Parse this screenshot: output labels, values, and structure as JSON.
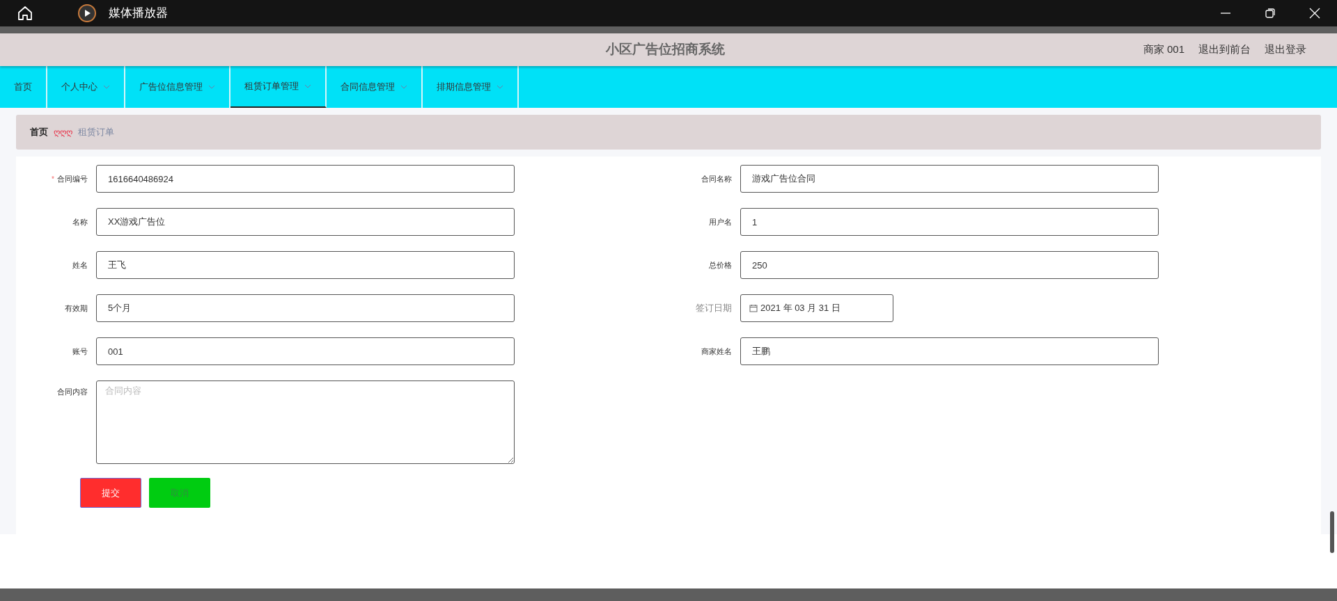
{
  "window": {
    "title": "媒体播放器"
  },
  "header": {
    "title": "小区广告位招商系统",
    "links": [
      "商家 001",
      "退出到前台",
      "退出登录"
    ]
  },
  "nav": [
    {
      "label": "首页",
      "dropdown": false,
      "selected": false
    },
    {
      "label": "个人中心",
      "dropdown": true,
      "selected": false
    },
    {
      "label": "广告位信息管理",
      "dropdown": true,
      "selected": false
    },
    {
      "label": "租赁订单管理",
      "dropdown": true,
      "selected": true
    },
    {
      "label": "合同信息管理",
      "dropdown": true,
      "selected": false
    },
    {
      "label": "排期信息管理",
      "dropdown": true,
      "selected": false
    }
  ],
  "breadcrumb": {
    "home": "首页",
    "separator": "ღღღ",
    "current": "租赁订单"
  },
  "form": {
    "required_mark": "*",
    "left": [
      {
        "label": "合同编号",
        "value": "1616640486924",
        "required": true,
        "kind": "text"
      },
      {
        "label": "名称",
        "value": "XX游戏广告位",
        "required": false,
        "kind": "text"
      },
      {
        "label": "姓名",
        "value": "王飞",
        "required": false,
        "kind": "text"
      },
      {
        "label": "有效期",
        "value": "5个月",
        "required": false,
        "kind": "text"
      },
      {
        "label": "账号",
        "value": "001",
        "required": false,
        "kind": "text"
      },
      {
        "label": "合同内容",
        "placeholder": "合同内容",
        "required": false,
        "kind": "textarea"
      }
    ],
    "right": [
      {
        "label": "合同名称",
        "value": "游戏广告位合同",
        "required": false,
        "kind": "text"
      },
      {
        "label": "用户名",
        "value": "1",
        "required": false,
        "kind": "text"
      },
      {
        "label": "总价格",
        "value": "250",
        "required": false,
        "kind": "text"
      },
      {
        "label": "签订日期",
        "value": "2021 年 03 月 31 日",
        "required": false,
        "kind": "date"
      },
      {
        "label": "商家姓名",
        "value": "王鹏",
        "required": false,
        "kind": "text"
      }
    ],
    "buttons": [
      {
        "label": "提交",
        "kind": "primary"
      },
      {
        "label": "取消",
        "kind": "cancel"
      }
    ]
  }
}
